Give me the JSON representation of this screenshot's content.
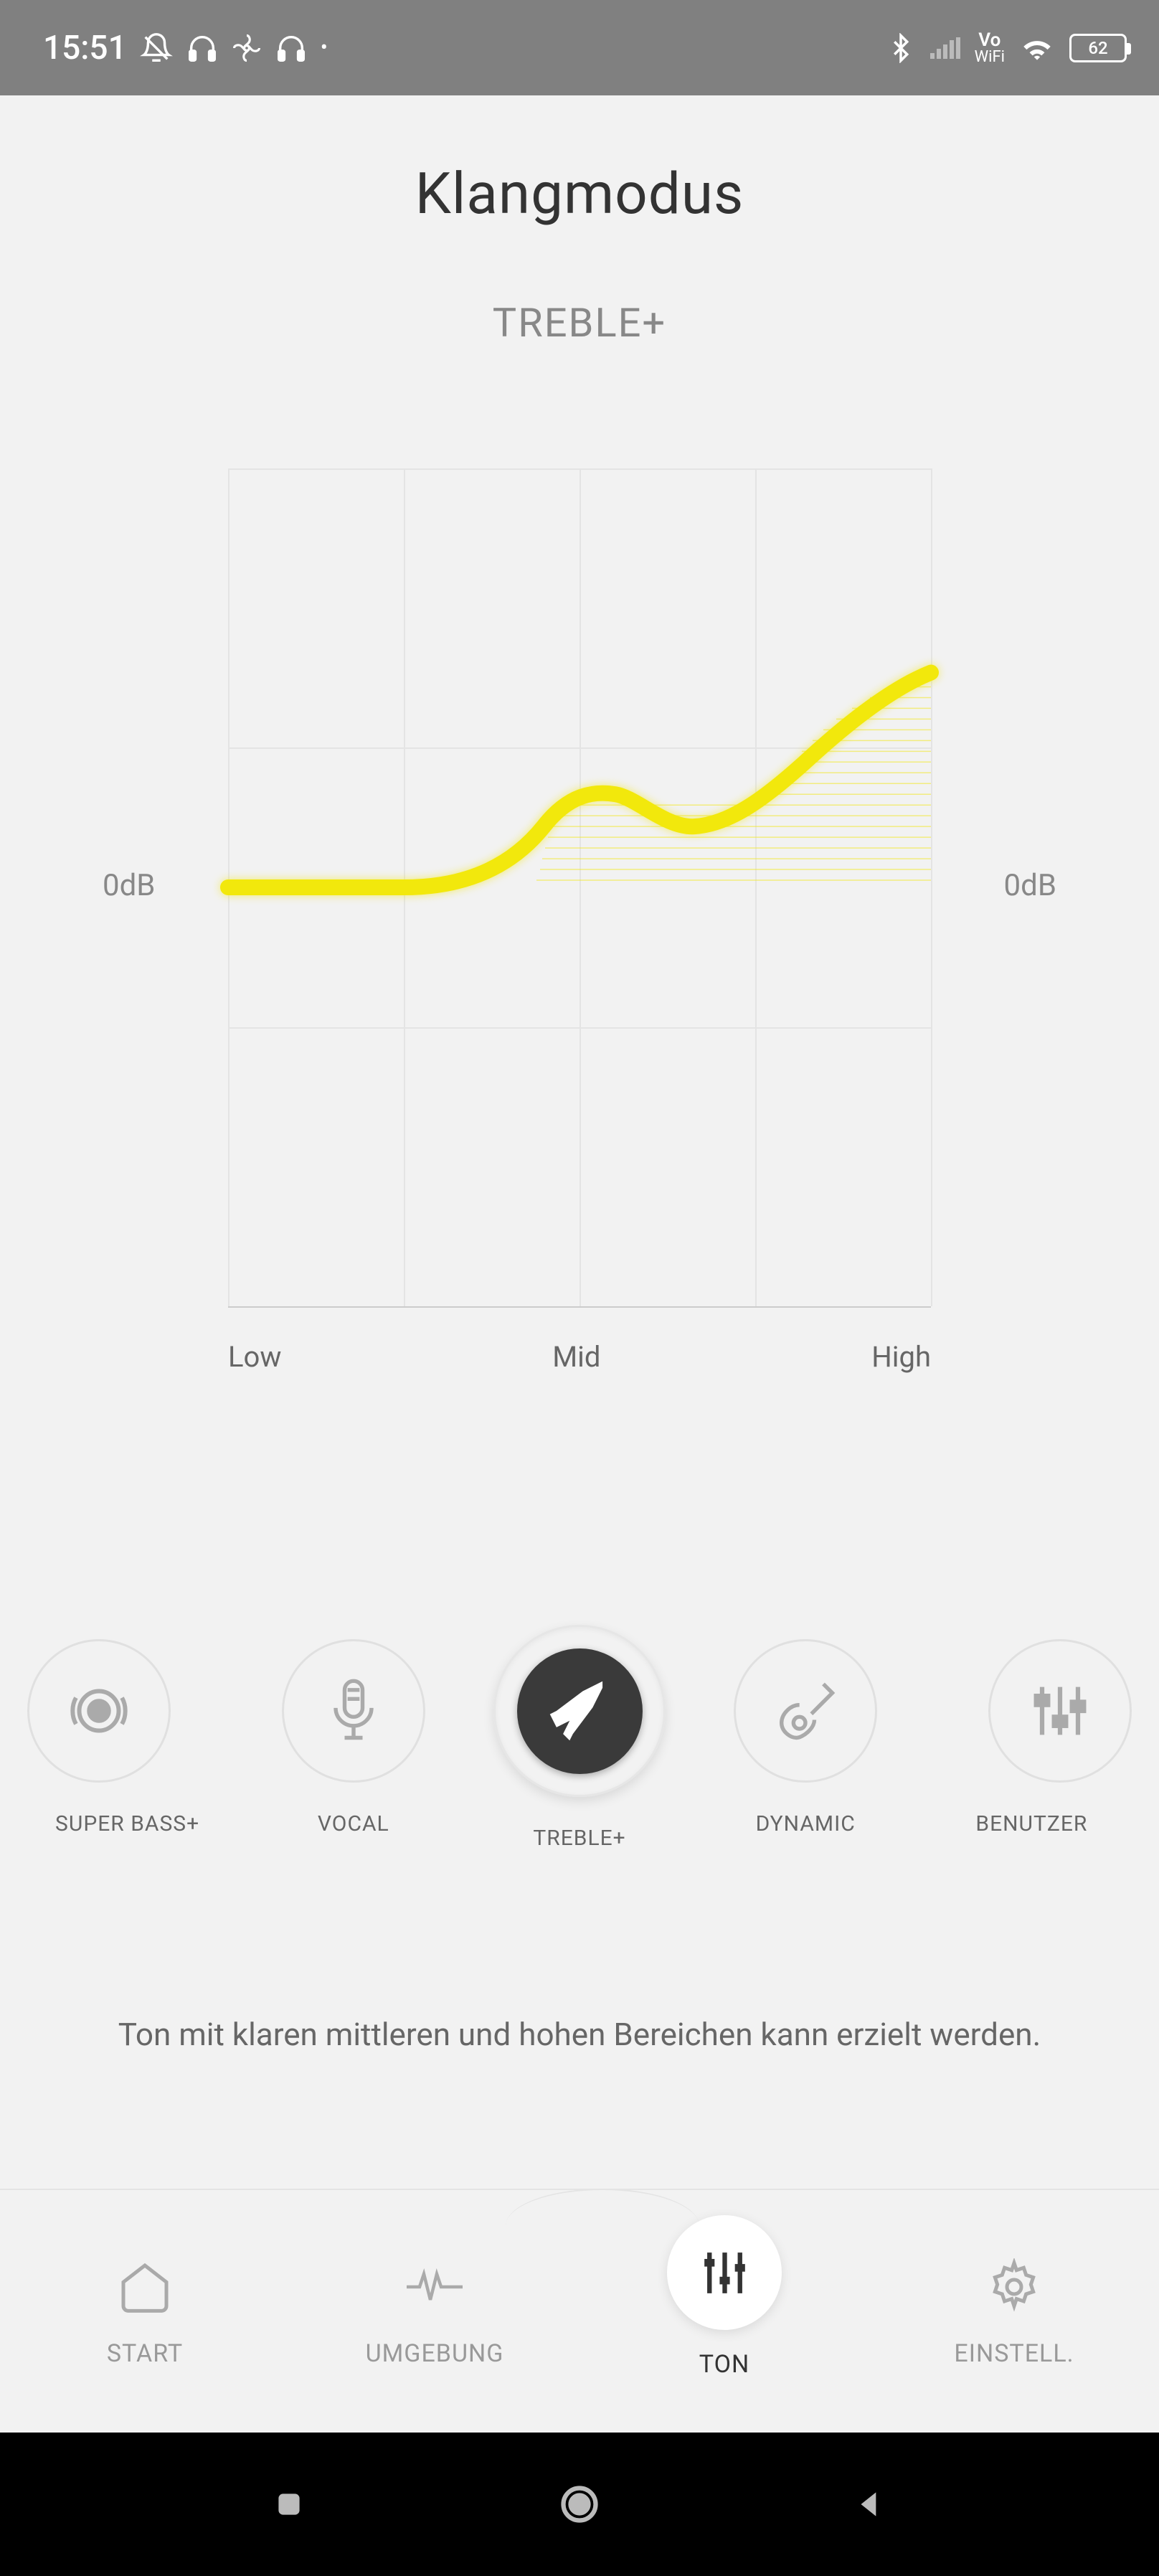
{
  "status": {
    "time": "15:51",
    "battery": "62",
    "vowifi_top": "Vo",
    "vowifi_bottom": "WiFi"
  },
  "page_title": "Klangmodus",
  "mode_name": "TREBLE+",
  "axis": {
    "left": "0dB",
    "right": "0dB"
  },
  "ticks": {
    "low": "Low",
    "mid": "Mid",
    "high": "High"
  },
  "modes": {
    "superbass": "SUPER BASS+",
    "vocal": "VOCAL",
    "treble": "TREBLE+",
    "dynamic": "DYNAMIC",
    "user": "BENUTZER"
  },
  "description": "Ton mit klaren mittleren und hohen Bereichen kann erzielt werden.",
  "tabs": {
    "start": "START",
    "umgebung": "UMGEBUNG",
    "ton": "TON",
    "einstell": "EINSTELL."
  },
  "chart_data": {
    "type": "line",
    "title": "TREBLE+",
    "xlabel": "",
    "ylabel": "dB",
    "x_categories": [
      "Low",
      "Mid",
      "High"
    ],
    "ylim": [
      -6,
      6
    ],
    "baseline_db": 0,
    "series": [
      {
        "name": "TREBLE+ EQ curve",
        "x": [
          0.0,
          0.25,
          0.4,
          0.5,
          0.6,
          0.7,
          0.8,
          1.0
        ],
        "y_db": [
          0.0,
          0.0,
          1.0,
          3.0,
          2.4,
          2.0,
          3.0,
          6.0
        ]
      }
    ],
    "color": "#f2e80c"
  }
}
